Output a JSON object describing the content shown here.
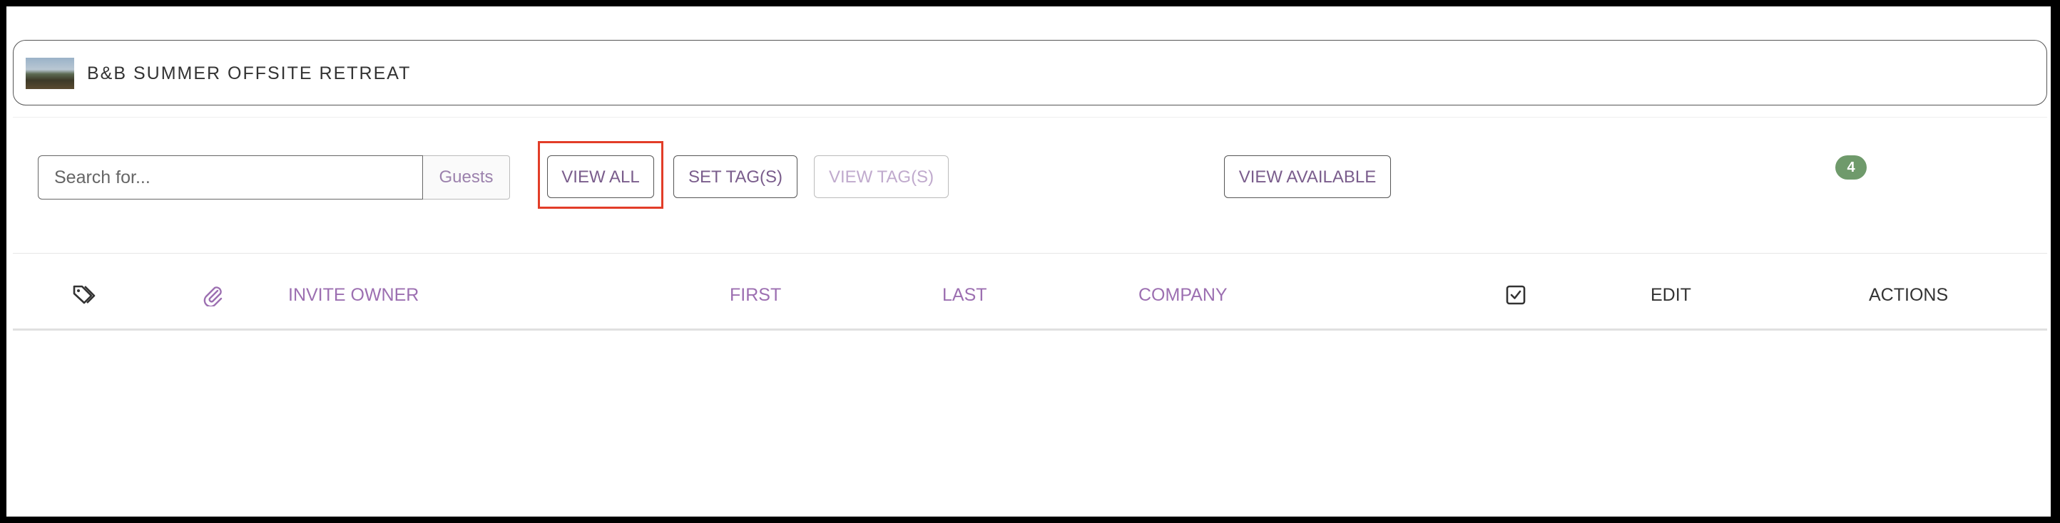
{
  "event": {
    "title": "B&B SUMMER OFFSITE RETREAT",
    "thumbnail_icon": "event-landscape-thumbnail"
  },
  "toolbar": {
    "search_placeholder": "Search for...",
    "search_value": "",
    "search_scope": "Guests",
    "view_all_label": "VIEW ALL",
    "set_tags_label": "SET TAG(S)",
    "view_tags_label": "VIEW TAG(S)",
    "view_available_label": "VIEW AVAILABLE",
    "count_badge": "4",
    "highlight_color": "#e23d28"
  },
  "table": {
    "columns": {
      "tags_icon": "tag-icon",
      "attachment_icon": "paperclip-icon",
      "invite_owner": "INVITE OWNER",
      "first": "FIRST",
      "last": "LAST",
      "company": "COMPANY",
      "checked_icon": "checkbox-checked-icon",
      "edit": "EDIT",
      "actions": "ACTIONS"
    },
    "rows": []
  },
  "colors": {
    "accent_purple": "#7a5d8c",
    "header_purple": "#9c6fb1",
    "badge_green": "#6f9a6b"
  }
}
